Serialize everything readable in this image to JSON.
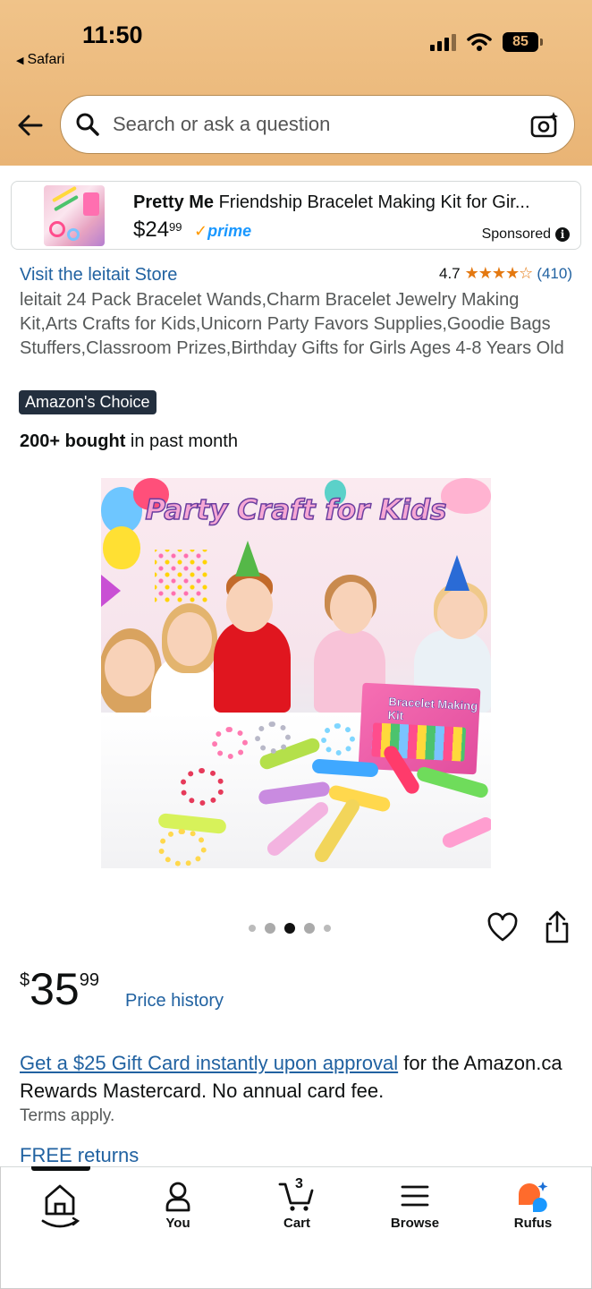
{
  "status_bar": {
    "time": "11:50",
    "back_app": "Safari",
    "battery": "85"
  },
  "search": {
    "placeholder": "Search or ask a question"
  },
  "sponsored_ad": {
    "brand": "Pretty Me",
    "title_rest": " Friendship Bracelet Making Kit for Gir...",
    "price_dollars": "$24",
    "price_cents": "99",
    "prime_label": "prime",
    "sponsored_label": "Sponsored"
  },
  "product": {
    "store_link": "Visit the leitait Store",
    "rating_value": "4.7",
    "rating_stars": 4.7,
    "rating_count": "(410)",
    "title": "leitait 24 Pack Bracelet Wands,Charm Bracelet Jewelry Making Kit,Arts Crafts for Kids,Unicorn Party Favors Supplies,Goodie Bags Stuffers,Classroom Prizes,Birthday Gifts for Girls Ages 4-8 Years Old",
    "badge": "Amazon's Choice",
    "bought_bold": "200+ bought",
    "bought_rest": " in past month",
    "image_headline": "Party Craft for Kids",
    "image_box_label": "Bracelet Making Kit",
    "carousel": {
      "total": 5,
      "active_index": 2
    },
    "price_currency": "$",
    "price_whole": "35",
    "price_fraction": "99",
    "price_history_label": "Price history"
  },
  "promo": {
    "link_text": "Get a $25 Gift Card instantly upon approval",
    "rest_text": " for the Amazon.ca Rewards Mastercard. No annual card fee.",
    "terms": "Terms apply.",
    "free_returns": "FREE returns"
  },
  "bottom_nav": {
    "items": [
      {
        "label": "",
        "icon": "home-icon"
      },
      {
        "label": "You",
        "icon": "person-icon"
      },
      {
        "label": "Cart",
        "icon": "cart-icon",
        "count": "3"
      },
      {
        "label": "Browse",
        "icon": "menu-icon"
      },
      {
        "label": "Rufus",
        "icon": "rufus-icon"
      }
    ]
  },
  "colors": {
    "header_bg": "#e9b475",
    "link": "#2162a1",
    "star": "#e47911",
    "badge_bg": "#232f3e",
    "prime": "#1a98ff"
  }
}
